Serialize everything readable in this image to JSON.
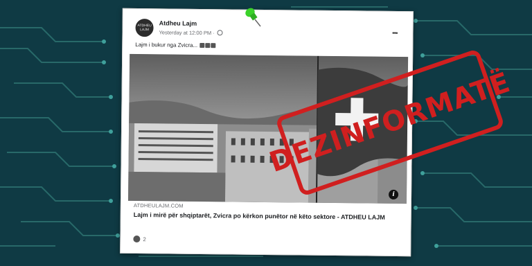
{
  "post": {
    "page_name": "Atdheu Lajm",
    "timestamp": "Yesterday at 12:00 PM",
    "caption": "Lajm i bukur nga Zvicra...",
    "avatar_line1": "ATDHEU",
    "avatar_line2": "LAJM",
    "link_domain": "ATDHEULAJM.COM",
    "link_title": "Lajm i mirë për shqiptarët, Zvicra po kërkon punëtor në këto sektore - ATDHEU LAJM",
    "reaction_count": "2",
    "more_glyph": "•••",
    "info_glyph": "i"
  },
  "stamp": {
    "text": "DEZINFORMATË",
    "color": "#d01f1f"
  },
  "colors": {
    "background": "#0f3a44",
    "circuit": "#2b6f6e",
    "pin": "#3bd22a"
  },
  "icons": [
    "globe-icon",
    "more-options-icon",
    "info-icon",
    "like-icon",
    "push-pin-icon"
  ]
}
